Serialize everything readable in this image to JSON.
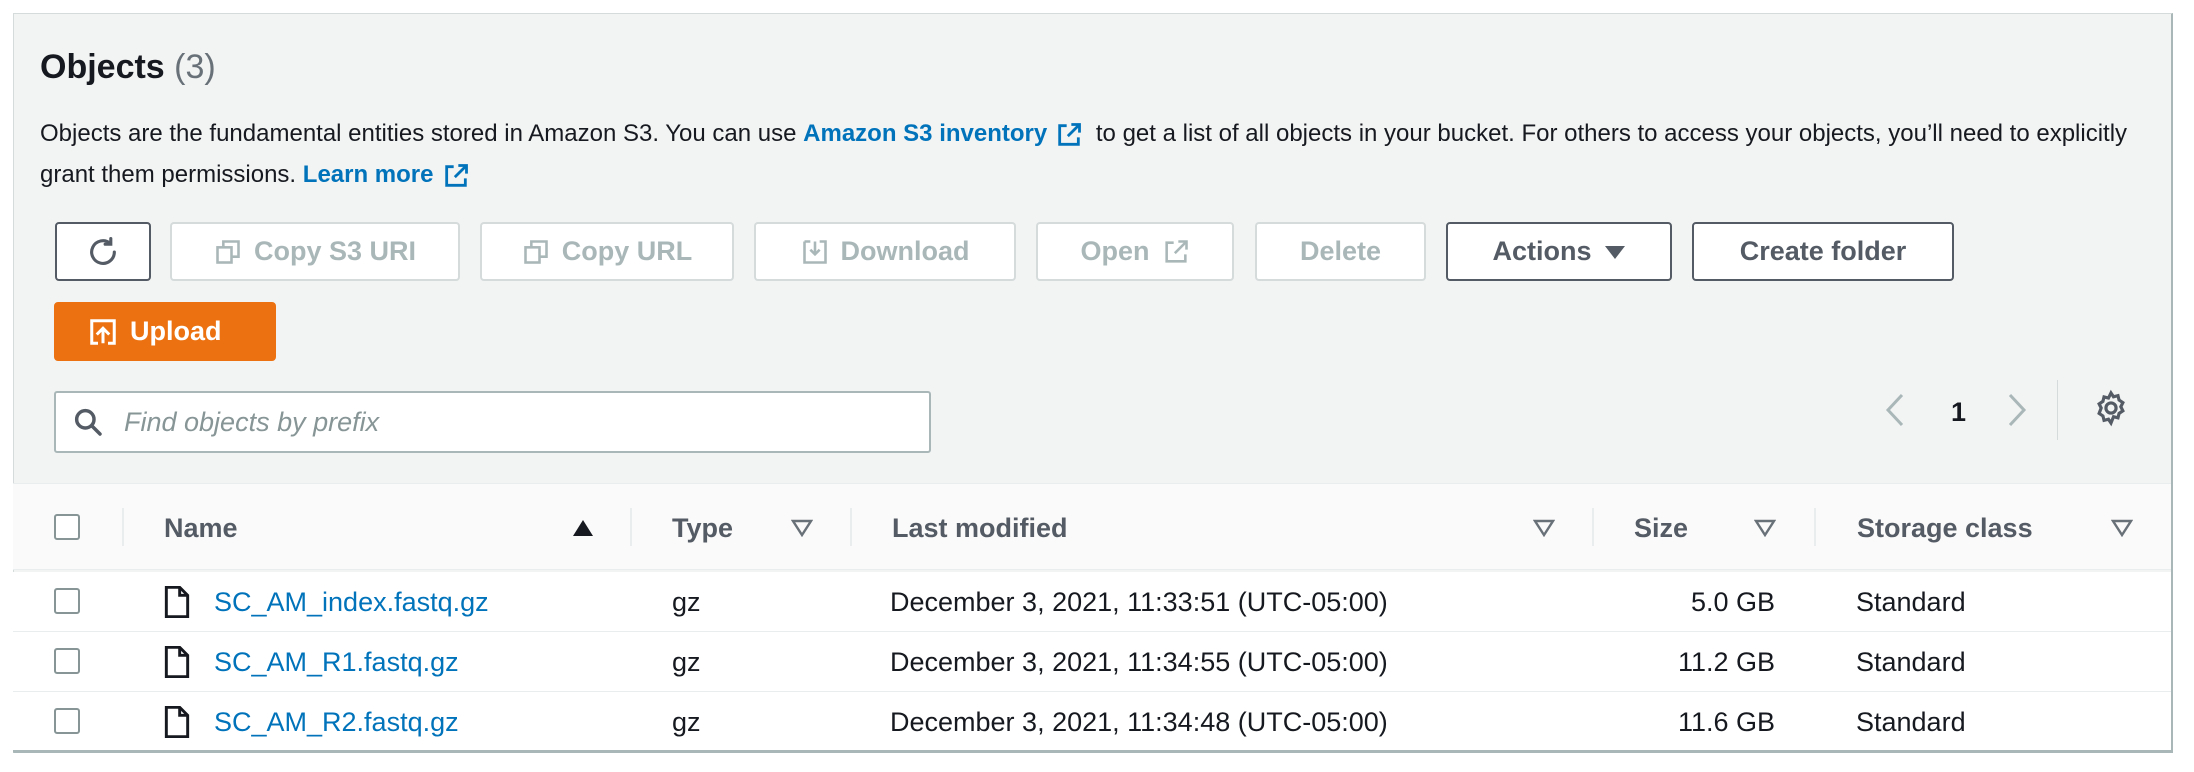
{
  "header": {
    "title": "Objects",
    "count": "(3)"
  },
  "description": {
    "part1": "Objects are the fundamental entities stored in Amazon S3. You can use ",
    "inventory_link": "Amazon S3 inventory",
    "part2": " to get a list of all objects in your bucket. For others to access your objects, you’ll need to explicitly grant them permissions. ",
    "learn_more": "Learn more"
  },
  "toolbar": {
    "refresh_icon": "refresh-icon",
    "copy_s3_uri": "Copy S3 URI",
    "copy_url": "Copy URL",
    "download": "Download",
    "open": "Open",
    "delete": "Delete",
    "actions": "Actions",
    "create_folder": "Create folder",
    "upload": "Upload"
  },
  "search": {
    "placeholder": "Find objects by prefix",
    "value": ""
  },
  "pagination": {
    "current_page": "1"
  },
  "table": {
    "columns": [
      "Name",
      "Type",
      "Last modified",
      "Size",
      "Storage class"
    ],
    "rows": [
      {
        "name": "SC_AM_index.fastq.gz",
        "type": "gz",
        "last_modified": "December 3, 2021, 11:33:51 (UTC-05:00)",
        "size": "5.0 GB",
        "storage_class": "Standard"
      },
      {
        "name": "SC_AM_R1.fastq.gz",
        "type": "gz",
        "last_modified": "December 3, 2021, 11:34:55 (UTC-05:00)",
        "size": "11.2 GB",
        "storage_class": "Standard"
      },
      {
        "name": "SC_AM_R2.fastq.gz",
        "type": "gz",
        "last_modified": "December 3, 2021, 11:34:48 (UTC-05:00)",
        "size": "11.6 GB",
        "storage_class": "Standard"
      }
    ]
  },
  "colors": {
    "link": "#0073bb",
    "primary": "#ec7211",
    "panel_bg": "#f2f3f3"
  }
}
